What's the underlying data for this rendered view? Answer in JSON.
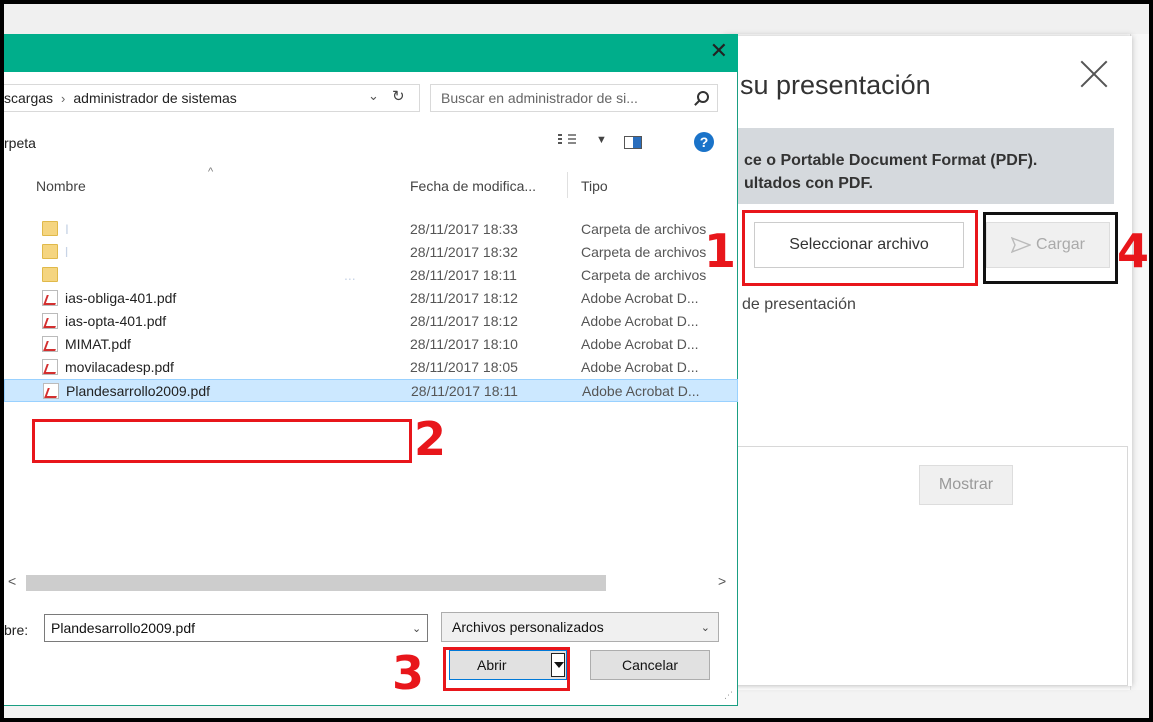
{
  "web": {
    "title": "su presentación",
    "info_line1": "ce o Portable Document Format (PDF).",
    "info_line2": "ultados con PDF.",
    "select_label": "Seleccionar archivo",
    "load_label": "Cargar",
    "subtext": "de presentación",
    "show_label": "Mostrar"
  },
  "dialog": {
    "close_glyph": "✕",
    "breadcrumb": [
      "scargas",
      "administrador de sistemas"
    ],
    "search_placeholder": "Buscar en administrador de si...",
    "toolbar_label": "rpeta",
    "help_glyph": "?",
    "columns": {
      "name": "Nombre",
      "date": "Fecha de modifica...",
      "type": "Tipo"
    },
    "files": [
      {
        "kind": "folder",
        "name": "I",
        "date": "28/11/2017 18:33",
        "type": "Carpeta de archivos"
      },
      {
        "kind": "folder",
        "name": "l",
        "date": "28/11/2017 18:32",
        "type": "Carpeta de archivos"
      },
      {
        "kind": "folder",
        "name": "...",
        "date": "28/11/2017 18:11",
        "type": "Carpeta de archivos"
      },
      {
        "kind": "pdf",
        "name": "ias-obliga-401.pdf",
        "date": "28/11/2017 18:12",
        "type": "Adobe Acrobat D..."
      },
      {
        "kind": "pdf",
        "name": "ias-opta-401.pdf",
        "date": "28/11/2017 18:12",
        "type": "Adobe Acrobat D..."
      },
      {
        "kind": "pdf",
        "name": "MIMAT.pdf",
        "date": "28/11/2017 18:10",
        "type": "Adobe Acrobat D..."
      },
      {
        "kind": "pdf",
        "name": "movilacadesp.pdf",
        "date": "28/11/2017 18:05",
        "type": "Adobe Acrobat D..."
      },
      {
        "kind": "pdf",
        "name": "Plandesarrollo2009.pdf",
        "date": "28/11/2017 18:11",
        "type": "Adobe Acrobat D...",
        "selected": true
      }
    ],
    "filename_label": "bre:",
    "filename_value": "Plandesarrollo2009.pdf",
    "filetype_value": "Archivos personalizados",
    "open_label": "Abrir",
    "cancel_label": "Cancelar"
  },
  "annotations": {
    "step1": "1",
    "step2": "2",
    "step3": "3",
    "step4": "4",
    "color": "#e8161b"
  },
  "colors": {
    "titlebar": "#00ae8b",
    "selection": "#cce8ff",
    "accent_blue": "#0078d7"
  }
}
